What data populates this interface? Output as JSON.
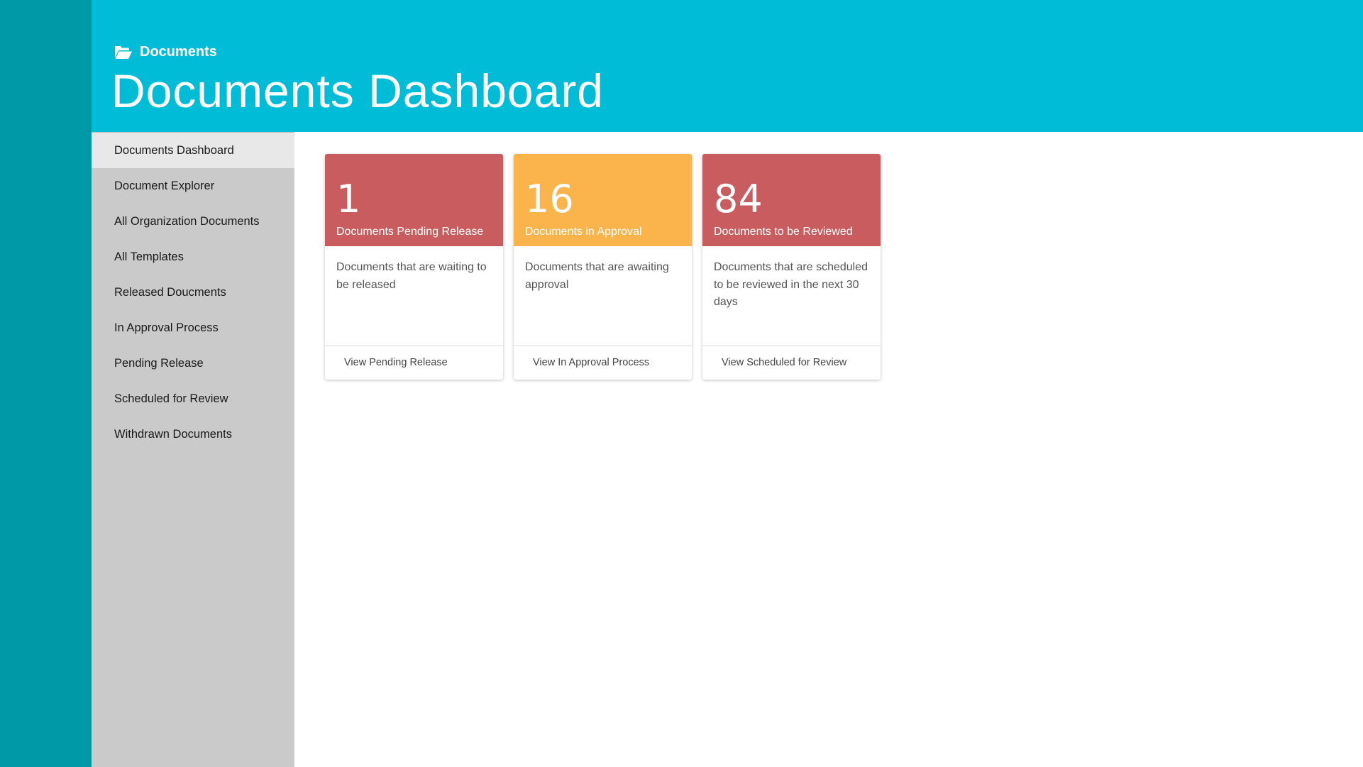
{
  "header": {
    "breadcrumb_label": "Documents",
    "breadcrumb_icon": "folder-open-icon",
    "title": "Documents Dashboard"
  },
  "sidebar": {
    "items": [
      {
        "label": "Documents Dashboard",
        "active": true
      },
      {
        "label": "Document Explorer",
        "active": false
      },
      {
        "label": "All Organization Documents",
        "active": false
      },
      {
        "label": "All Templates",
        "active": false
      },
      {
        "label": "Released Doucments",
        "active": false
      },
      {
        "label": "In Approval Process",
        "active": false
      },
      {
        "label": "Pending Release",
        "active": false
      },
      {
        "label": "Scheduled for Review",
        "active": false
      },
      {
        "label": "Withdrawn Documents",
        "active": false
      }
    ]
  },
  "cards": [
    {
      "count": "1",
      "title": "Documents Pending Release",
      "description": "Documents that are waiting to be released",
      "link": "View Pending Release",
      "color": "#c85c5f"
    },
    {
      "count": "16",
      "title": "Documents in Approval",
      "description": "Documents that are awaiting approval",
      "link": "View In Approval Process",
      "color": "#fbb44c"
    },
    {
      "count": "84",
      "title": "Documents to be Reviewed",
      "description": "Documents that are scheduled to be reviewed in the next 30 days",
      "link": "View Scheduled for Review",
      "color": "#c85c5f"
    }
  ],
  "colors": {
    "rail": "#0099a8",
    "header": "#00bcd6",
    "sidebar": "#cacaca",
    "sidebar_active": "#e8e8e8"
  }
}
